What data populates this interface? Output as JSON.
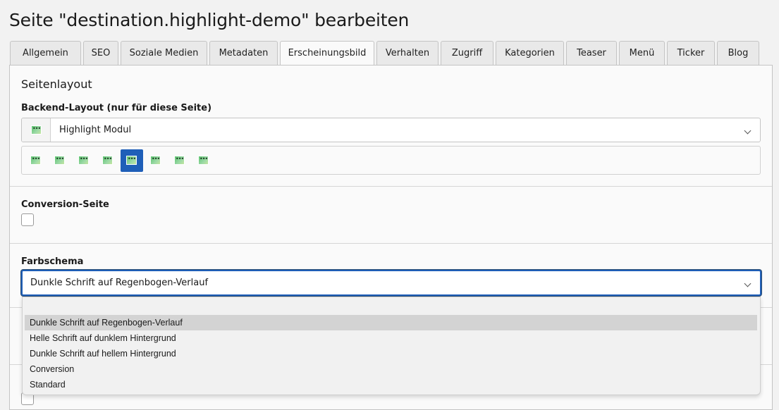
{
  "page": {
    "title": "Seite \"destination.highlight-demo\" bearbeiten"
  },
  "tabs": [
    {
      "label": "Allgemein",
      "active": false
    },
    {
      "label": "SEO",
      "active": false
    },
    {
      "label": "Soziale Medien",
      "active": false
    },
    {
      "label": "Metadaten",
      "active": false
    },
    {
      "label": "Erscheinungsbild",
      "active": true
    },
    {
      "label": "Verhalten",
      "active": false
    },
    {
      "label": "Zugriff",
      "active": false
    },
    {
      "label": "Kategorien",
      "active": false
    },
    {
      "label": "Teaser",
      "active": false
    },
    {
      "label": "Menü",
      "active": false
    },
    {
      "label": "Ticker",
      "active": false
    },
    {
      "label": "Blog",
      "active": false
    }
  ],
  "section": {
    "heading": "Seitenlayout"
  },
  "backend_layout": {
    "label": "Backend-Layout (nur für diese Seite)",
    "value": "Highlight Modul",
    "icon": "layout-thumbnail-icon",
    "options_count_visible": 8,
    "selected_index": 4
  },
  "conversion": {
    "label": "Conversion-Seite",
    "checked": false
  },
  "farbschema": {
    "label": "Farbschema",
    "value": "Dunkle Schrift auf Regenbogen-Verlauf",
    "options": [
      "",
      "Dunkle Schrift auf Regenbogen-Verlauf",
      "Helle Schrift auf dunklem Hintergrund",
      "Dunkle Schrift auf hellem Hintergrund",
      "Conversion",
      "Standard"
    ],
    "highlighted_index": 1
  },
  "colors": {
    "focus_border": "#1f5fb8",
    "selected_thumb_bg": "#1f5fb8",
    "panel_bg": "#fafafa",
    "page_bg": "#f2f2f2"
  }
}
